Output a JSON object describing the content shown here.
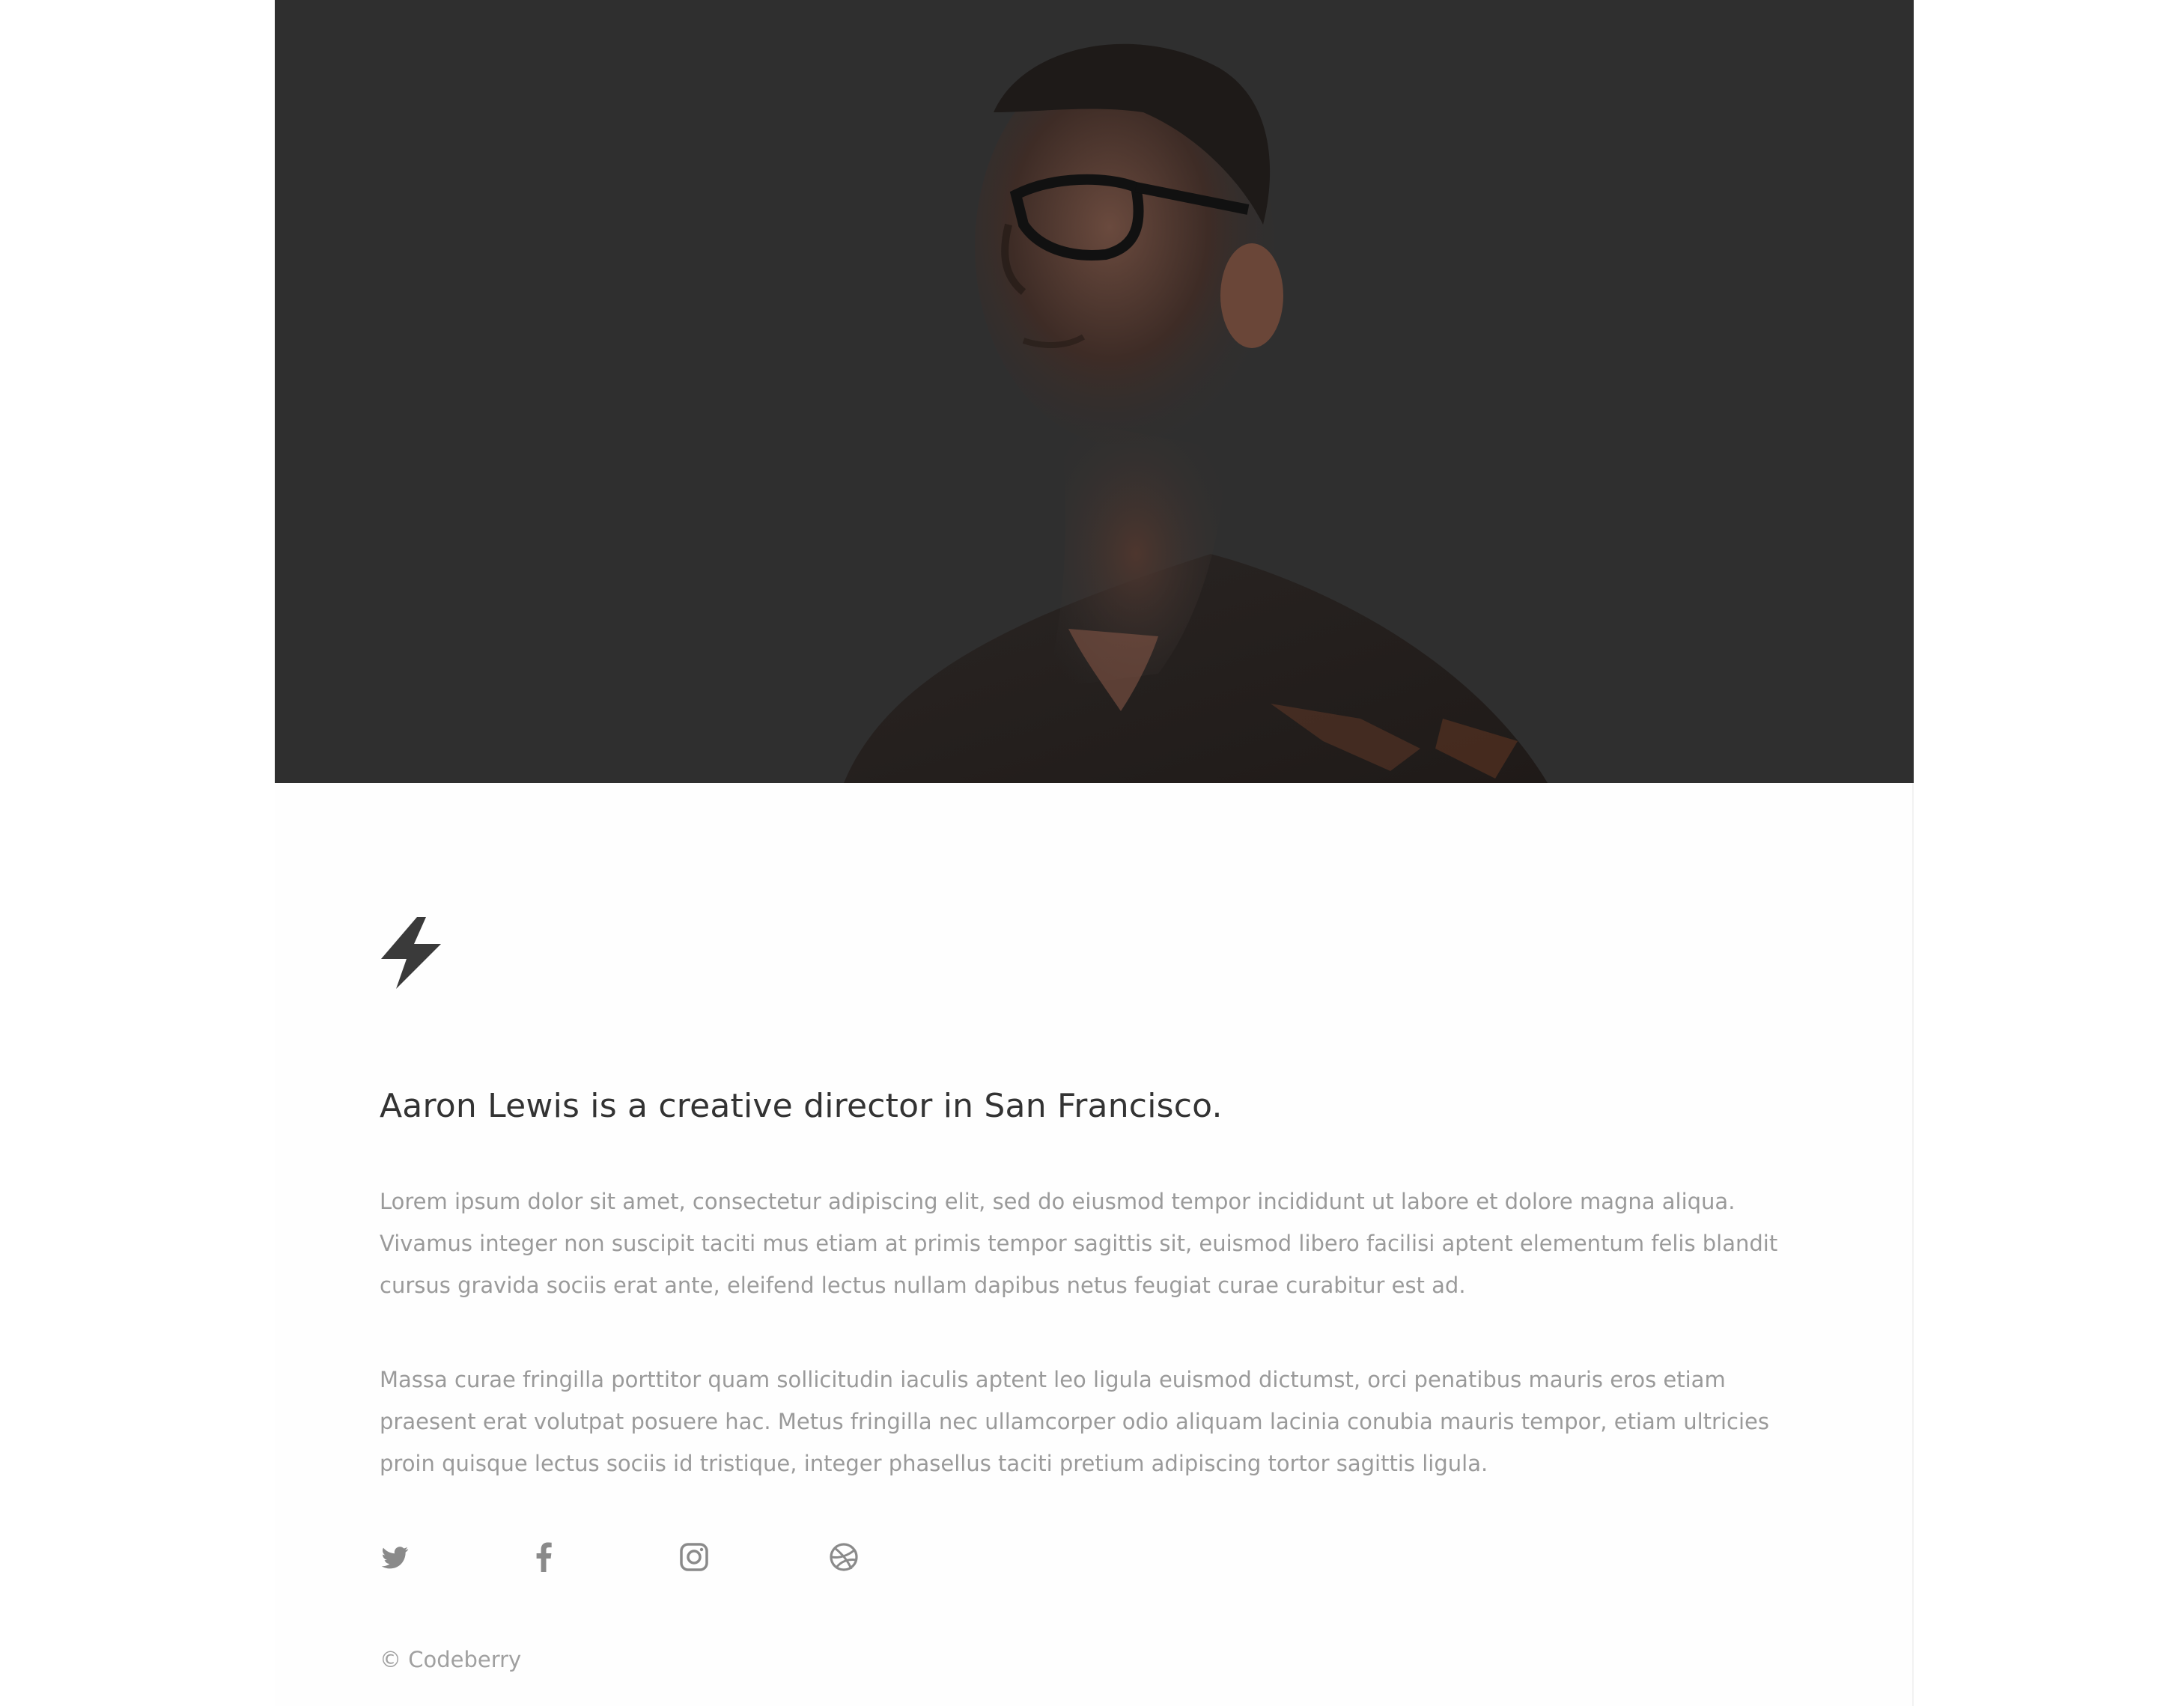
{
  "hero": {
    "image_alt": "Portrait of a man with glasses in dark lighting"
  },
  "icons": {
    "logo": "lightning-bolt-icon",
    "social": [
      "twitter-icon",
      "facebook-icon",
      "instagram-icon",
      "dribbble-icon"
    ]
  },
  "headline": "Aaron Lewis is a creative director in San Francisco.",
  "paragraphs": [
    "Lorem ipsum dolor sit amet, consectetur adipiscing elit, sed do eiusmod tempor incididunt ut labore et dolore magna aliqua. Vivamus integer non suscipit taciti mus etiam at primis tempor sagittis sit, euismod libero facilisi aptent elementum felis blandit cursus gravida sociis erat ante, eleifend lectus nullam dapibus netus feugiat curae curabitur est ad.",
    "Massa curae fringilla porttitor quam sollicitudin iaculis aptent leo ligula euismod dictumst, orci penatibus mauris eros etiam praesent erat volutpat posuere hac. Metus fringilla nec ullamcorper odio aliquam lacinia conubia mauris tempor, etiam ultricies proin quisque lectus sociis id tristique, integer phasellus taciti pretium adipiscing tortor sagittis ligula."
  ],
  "footer": {
    "copyright": "© Codeberry"
  },
  "colors": {
    "hero_background": "#2f2f2f",
    "headline": "#333333",
    "body_text": "#9a9a9a",
    "icon": "#8a8a8a"
  }
}
